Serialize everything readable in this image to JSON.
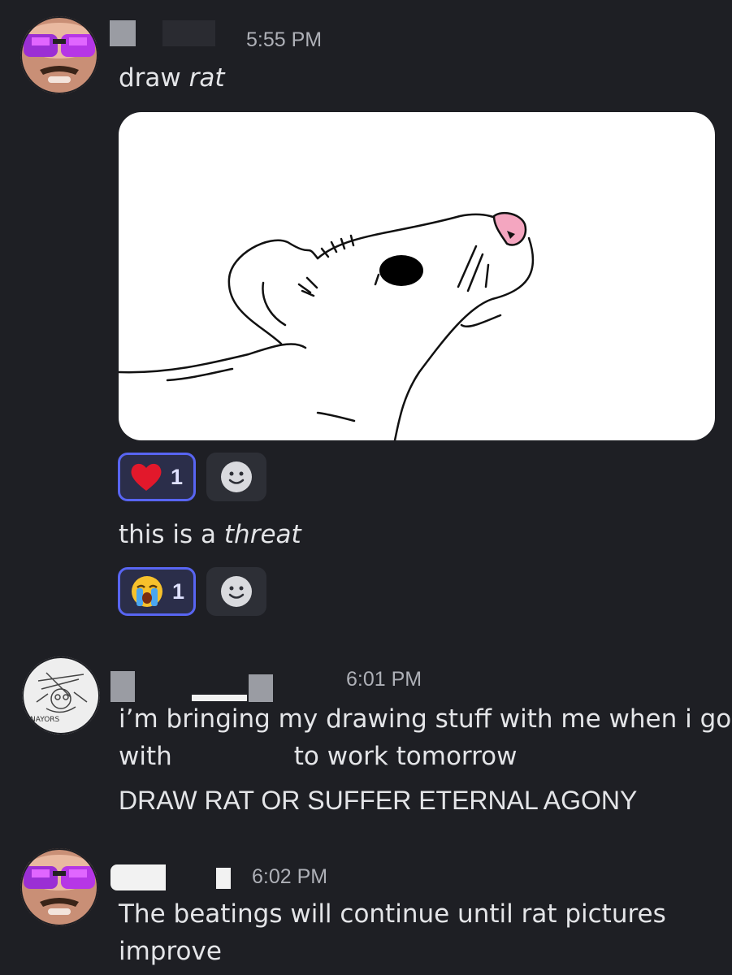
{
  "messages": [
    {
      "timestamp": "5:55 PM",
      "lines": [
        "draw",
        "rat"
      ],
      "reaction": {
        "emoji": "heart",
        "count": "1"
      }
    },
    {
      "lines": [
        "this is a",
        "threat"
      ],
      "reaction": {
        "emoji": "loudly-crying-face",
        "count": "1"
      }
    },
    {
      "timestamp": "6:01 PM",
      "lines": [
        "i’m bringing my drawing stuff with me when i go",
        "with",
        "to work tomorrow",
        "DRAW RAT OR SUFFER ETERNAL AGONY"
      ]
    },
    {
      "timestamp": "6:02 PM",
      "lines": [
        "The beatings will continue until rat pictures",
        "improve"
      ]
    }
  ],
  "colors": {
    "background": "#1e1f24",
    "reaction_active_border": "#5865f2",
    "rat_nose": "#f4a6c0"
  }
}
